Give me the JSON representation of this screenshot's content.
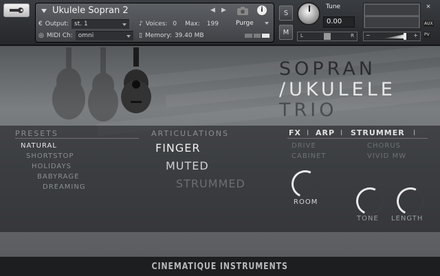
{
  "header": {
    "instrument_name": "Ukulele Sopran 2",
    "output_label": "Output:",
    "output_value": "st. 1",
    "voices_label": "Voices:",
    "voices_value": "0",
    "max_label": "Max:",
    "max_value": "199",
    "purge_label": "Purge",
    "midi_label": "MIDI Ch:",
    "midi_value": "omni",
    "memory_label": "Memory:",
    "memory_value": "39.40 MB",
    "solo_label": "S",
    "mute_label": "M",
    "tune_label": "Tune",
    "tune_value": "0.00",
    "pan_left": "L",
    "pan_right": "R",
    "aux_label": "AUX",
    "pv_label": "PV",
    "vol_minus": "−",
    "vol_plus": "+"
  },
  "title": {
    "line1": "SOPRAN",
    "line2": "/UKULELE",
    "line3": "TRIO"
  },
  "presets": {
    "heading": "PRESETS",
    "items": [
      "NATURAL",
      "SHORTSTOP",
      "HOLIDAYS",
      "BABYRAGE",
      "DREAMING"
    ],
    "selected": "NATURAL"
  },
  "articulations": {
    "heading": "ARTICULATIONS",
    "items": [
      "FINGER",
      "MUTED",
      "STRUMMED"
    ]
  },
  "tabs": {
    "fx": "FX",
    "arp": "ARP",
    "strummer": "STRUMMER",
    "sep": "I"
  },
  "fx": {
    "drive": "DRIVE",
    "cabinet": "CABINET",
    "chorus": "CHORUS",
    "vivid": "VIVID MW",
    "room": "ROOM",
    "tone": "TONE",
    "length": "LENGTH"
  },
  "footer": {
    "brand": "CINEMATIQUE INSTRUMENTS"
  }
}
